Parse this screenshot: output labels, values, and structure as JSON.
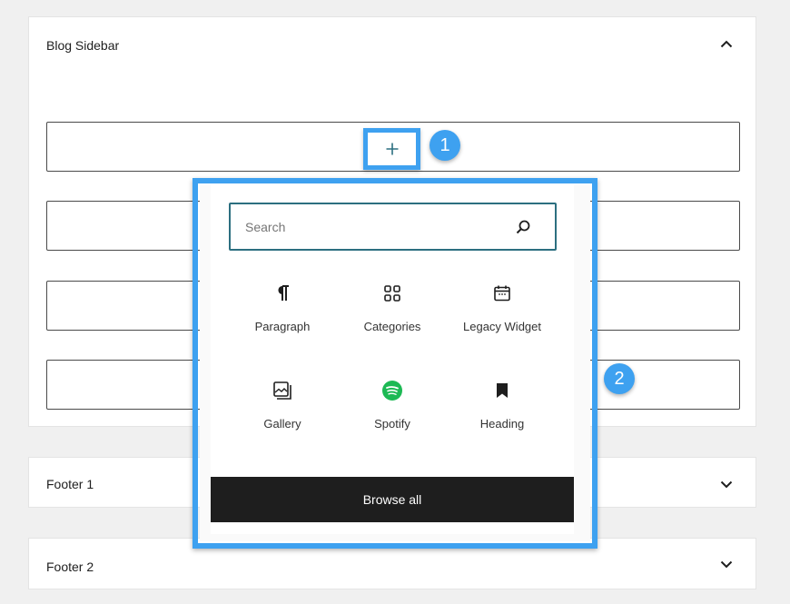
{
  "widget_areas": [
    {
      "title": "Blog Sidebar",
      "expanded": true,
      "toggle_icon": "chevron-up-icon"
    },
    {
      "title": "Footer 1",
      "expanded": false,
      "toggle_icon": "chevron-down-icon"
    },
    {
      "title": "Footer 2",
      "expanded": false,
      "toggle_icon": "chevron-down-icon"
    }
  ],
  "inserter": {
    "button_symbol": "+",
    "icon": "plus-icon"
  },
  "annotations": [
    {
      "number": "1",
      "color": "#3ea1f0"
    },
    {
      "number": "2",
      "color": "#3ea1f0"
    }
  ],
  "block_inserter": {
    "search": {
      "placeholder": "Search",
      "value": "",
      "icon": "search-icon"
    },
    "blocks": [
      {
        "label": "Paragraph",
        "icon": "paragraph-icon"
      },
      {
        "label": "Categories",
        "icon": "categories-icon"
      },
      {
        "label": "Legacy Widget",
        "icon": "calendar-icon"
      },
      {
        "label": "Gallery",
        "icon": "gallery-icon"
      },
      {
        "label": "Spotify",
        "icon": "spotify-icon",
        "icon_color": "#1db954"
      },
      {
        "label": "Heading",
        "icon": "bookmark-icon"
      }
    ],
    "browse_all_label": "Browse all"
  },
  "colors": {
    "highlight": "#3ea1f0",
    "search_border": "#2c6f80",
    "browse_bg": "#1e1e1e"
  }
}
